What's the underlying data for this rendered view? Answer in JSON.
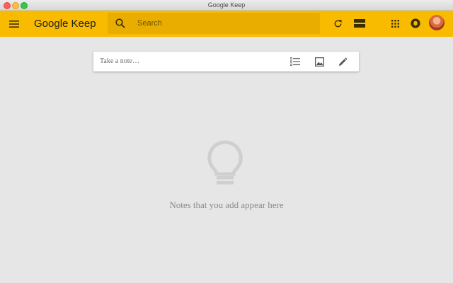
{
  "window": {
    "title": "Google Keep"
  },
  "header": {
    "logo_google": "Google",
    "logo_keep": "Keep",
    "search_placeholder": "Search",
    "accent_color": "#f9bb00"
  },
  "note_input": {
    "placeholder": "Take a note…"
  },
  "empty_state": {
    "message": "Notes that you add appear here"
  },
  "icons": {
    "menu": "menu-icon",
    "search": "search-icon",
    "refresh": "refresh-icon",
    "view": "list-view-icon",
    "apps": "apps-grid-icon",
    "notifications": "notifications-icon",
    "new_list": "checklist-icon",
    "new_image": "image-icon",
    "new_drawing": "pen-icon",
    "empty": "lightbulb-icon"
  }
}
